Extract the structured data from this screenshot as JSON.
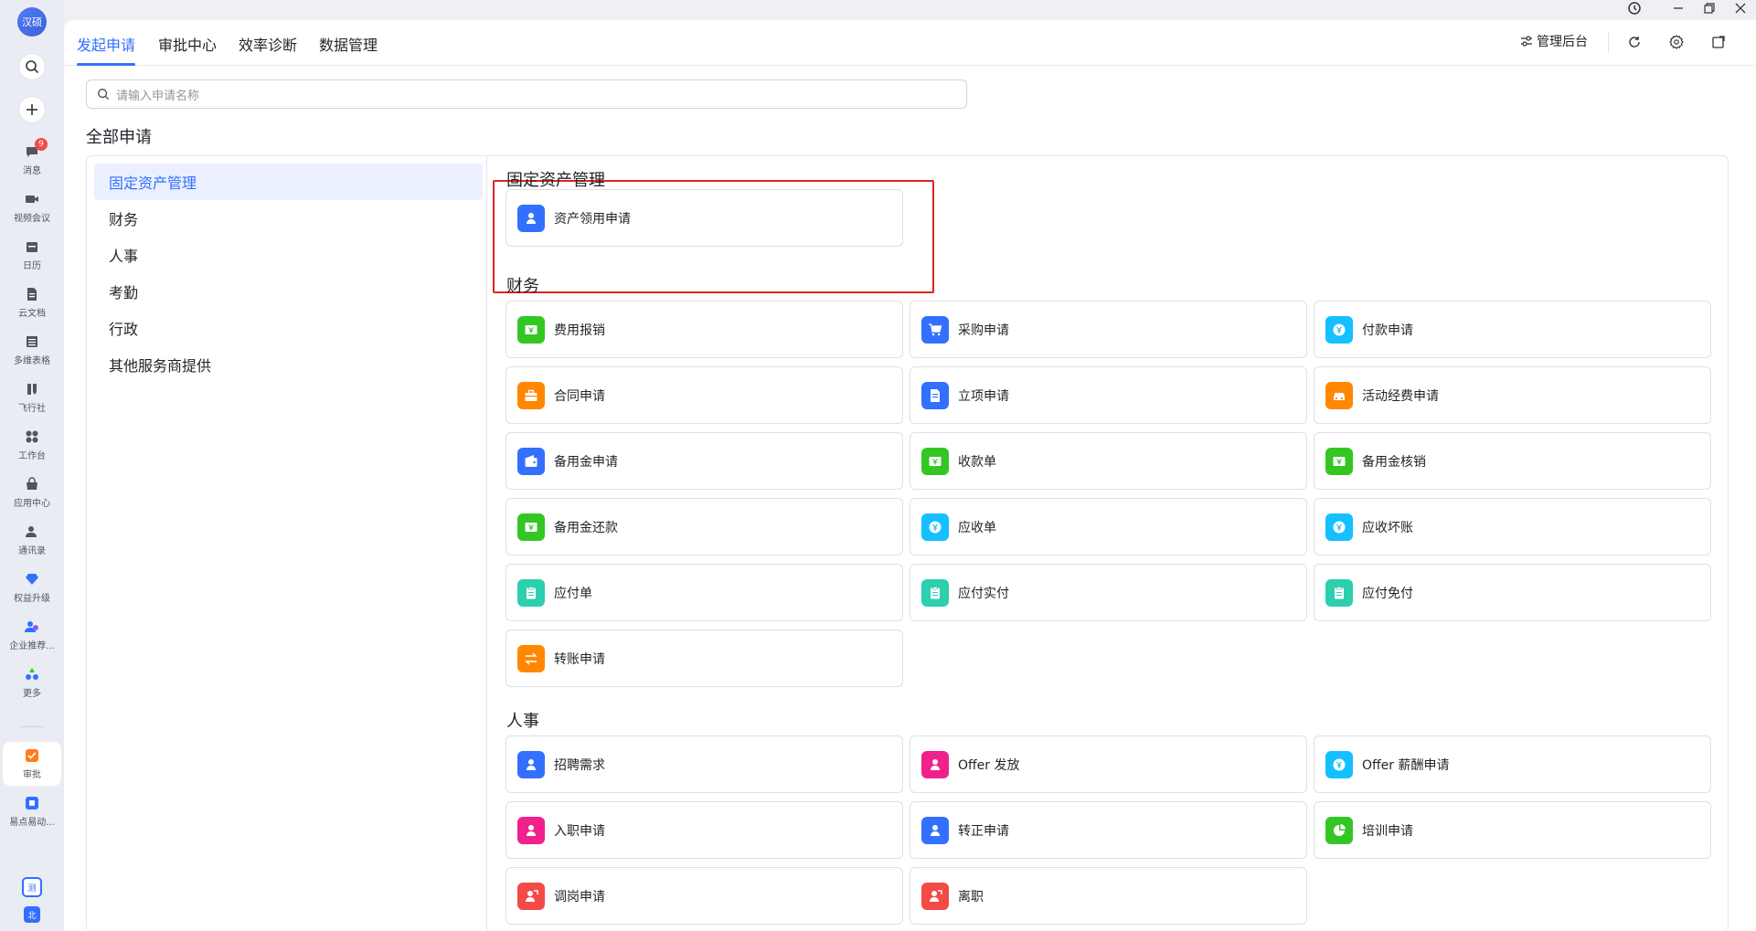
{
  "rail": {
    "avatar": "汉硕",
    "items": [
      {
        "label": "消息",
        "badge": "9"
      },
      {
        "label": "视频会议"
      },
      {
        "label": "日历"
      },
      {
        "label": "云文档"
      },
      {
        "label": "多维表格"
      },
      {
        "label": "飞行社"
      },
      {
        "label": "工作台"
      },
      {
        "label": "应用中心"
      },
      {
        "label": "通讯录"
      },
      {
        "label": "权益升级"
      },
      {
        "label": "企业推荐..."
      },
      {
        "label": "更多"
      },
      {
        "label": "审批"
      },
      {
        "label": "易点易动..."
      }
    ],
    "bottom": [
      "测",
      "北"
    ]
  },
  "topbar": {
    "tabs": [
      "发起申请",
      "审批中心",
      "效率诊断",
      "数据管理"
    ],
    "admin_label": "管理后台"
  },
  "search": {
    "placeholder": "请输入申请名称"
  },
  "page_title": "全部申请",
  "categories": [
    "固定资产管理",
    "财务",
    "人事",
    "考勤",
    "行政",
    "其他服务商提供"
  ],
  "sections": [
    {
      "title": "固定资产管理",
      "items": [
        {
          "label": "资产领用申请",
          "icon": "person-icon",
          "color": "#3370ff"
        }
      ]
    },
    {
      "title": "财务",
      "items": [
        {
          "label": "费用报销",
          "icon": "yen-bill-icon",
          "color": "#34c724"
        },
        {
          "label": "采购申请",
          "icon": "cart-icon",
          "color": "#3370ff"
        },
        {
          "label": "付款申请",
          "icon": "yen-coin-icon",
          "color": "#14c0ff"
        },
        {
          "label": "合同申请",
          "icon": "briefcase-icon",
          "color": "#ff8800"
        },
        {
          "label": "立项申请",
          "icon": "document-icon",
          "color": "#3370ff"
        },
        {
          "label": "活动经费申请",
          "icon": "car-icon",
          "color": "#ff8800"
        },
        {
          "label": "备用金申请",
          "icon": "wallet-icon",
          "color": "#3370ff"
        },
        {
          "label": "收款单",
          "icon": "yen-bill-icon",
          "color": "#34c724"
        },
        {
          "label": "备用金核销",
          "icon": "yen-bill-icon",
          "color": "#34c724"
        },
        {
          "label": "备用金还款",
          "icon": "yen-bill-icon",
          "color": "#34c724"
        },
        {
          "label": "应收单",
          "icon": "yen-coin-icon",
          "color": "#14c0ff"
        },
        {
          "label": "应收坏账",
          "icon": "yen-coin-icon",
          "color": "#14c0ff"
        },
        {
          "label": "应付单",
          "icon": "clipboard-icon",
          "color": "#2ccfae"
        },
        {
          "label": "应付实付",
          "icon": "clipboard-icon",
          "color": "#2ccfae"
        },
        {
          "label": "应付免付",
          "icon": "clipboard-icon",
          "color": "#2ccfae"
        },
        {
          "label": "转账申请",
          "icon": "transfer-icon",
          "color": "#ff8800"
        }
      ]
    },
    {
      "title": "人事",
      "items": [
        {
          "label": "招聘需求",
          "icon": "person-icon",
          "color": "#3370ff"
        },
        {
          "label": "Offer 发放",
          "icon": "person-icon",
          "color": "#f0218a"
        },
        {
          "label": "Offer 薪酬申请",
          "icon": "yen-coin-icon",
          "color": "#14c0ff"
        },
        {
          "label": "入职申请",
          "icon": "person-icon",
          "color": "#f0218a"
        },
        {
          "label": "转正申请",
          "icon": "person-icon",
          "color": "#3370ff"
        },
        {
          "label": "培训申请",
          "icon": "pie-icon",
          "color": "#34c724"
        },
        {
          "label": "调岗申请",
          "icon": "person-move-icon",
          "color": "#f54a45"
        },
        {
          "label": "离职",
          "icon": "person-move-icon",
          "color": "#f54a45"
        }
      ]
    }
  ]
}
